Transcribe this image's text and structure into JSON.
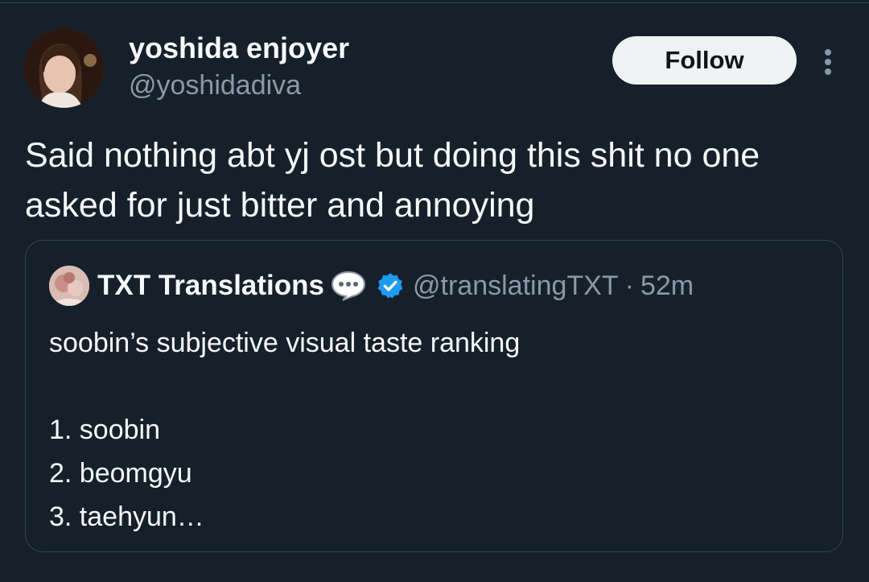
{
  "tweet": {
    "author": {
      "display_name": "yoshida enjoyer",
      "handle": "@yoshidadiva"
    },
    "follow_label": "Follow",
    "more_icon": "more-vertical-icon",
    "text": "Said nothing abt yj ost but doing this shit no one asked for just bitter and annoying"
  },
  "quoted_tweet": {
    "display_name": "TXT Translations",
    "badge_icons": [
      "speech-bubble-icon",
      "verified-badge-icon"
    ],
    "handle": "@translatingTXT",
    "separator": "·",
    "time": "52m",
    "lines": [
      "soobin’s subjective visual taste ranking",
      "",
      "1. soobin",
      "2. beomgyu",
      "3. taehyun…"
    ]
  },
  "colors": {
    "background": "#15202b",
    "border": "#38444d",
    "text_primary": "#f7f9f9",
    "text_secondary": "#8b98a5",
    "verified": "#1d9bf0",
    "follow_bg": "#eff3f4"
  }
}
